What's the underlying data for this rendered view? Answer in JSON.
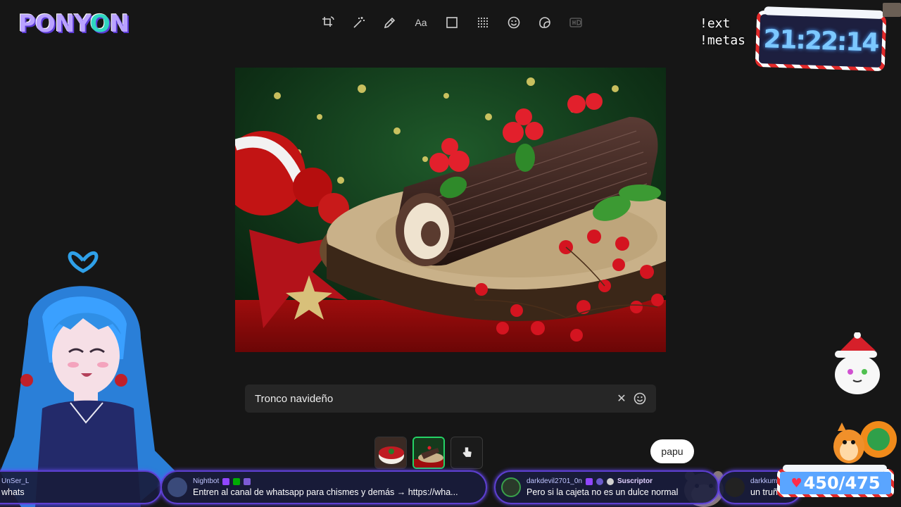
{
  "logo": {
    "text_a": "P",
    "text_b": "ONY",
    "text_c": "O",
    "text_d": "N"
  },
  "toolbar": {
    "tools": [
      {
        "icon": "crop-rotate-icon"
      },
      {
        "icon": "magic-wand-icon"
      },
      {
        "icon": "pencil-icon"
      },
      {
        "icon": "text-icon",
        "label": "Aa"
      },
      {
        "icon": "square-icon"
      },
      {
        "icon": "blur-grid-icon"
      },
      {
        "icon": "emoji-icon"
      },
      {
        "icon": "sticker-icon"
      },
      {
        "icon": "hd-icon"
      }
    ]
  },
  "overlay": {
    "commands": [
      "!ext",
      "!metas"
    ],
    "clock": "21:22:14",
    "counter": "450/475",
    "bubble": "papu"
  },
  "editor": {
    "caption_value": "Tronco navideño",
    "clear_icon": "close-icon",
    "emoji_icon": "emoji-icon"
  },
  "chat": [
    {
      "user": "Nightbot",
      "text": "Entren al canal de whatsapp para chismes y demás → https://wha..."
    },
    {
      "user": "darkdevil2701_0n",
      "badge_label": "Suscriptor",
      "text": "Pero si la cajeta no es un dulce normal"
    },
    {
      "user": "darkkuma",
      "text": "un truño"
    },
    {
      "user": "UnSer_L",
      "text": "whats"
    }
  ],
  "colors": {
    "background": "#161616",
    "accent": "#25d366",
    "chat_border": "#5d3fd0",
    "clock_text": "#7cc8ff"
  }
}
